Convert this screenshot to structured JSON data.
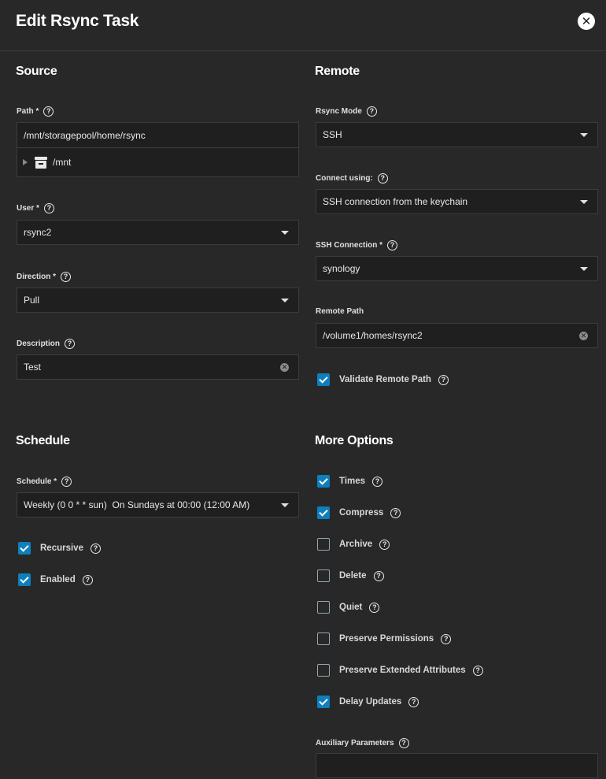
{
  "header": {
    "title": "Edit Rsync Task",
    "close_icon": "close-icon"
  },
  "source": {
    "title": "Source",
    "path_label": "Path *",
    "path_value": "/mnt/storagepool/home/rsync",
    "tree_node": "/mnt",
    "user_label": "User *",
    "user_value": "rsync2",
    "direction_label": "Direction *",
    "direction_value": "Pull",
    "description_label": "Description",
    "description_value": "Test"
  },
  "remote": {
    "title": "Remote",
    "mode_label": "Rsync Mode",
    "mode_value": "SSH",
    "connect_label": "Connect using:",
    "connect_value": "SSH connection from the keychain",
    "ssh_label": "SSH Connection *",
    "ssh_value": "synology",
    "path_label": "Remote Path",
    "path_value": "/volume1/homes/rsync2",
    "validate_label": "Validate Remote Path",
    "validate_checked": true
  },
  "schedule": {
    "title": "Schedule",
    "schedule_label": "Schedule *",
    "schedule_value": "Weekly (0 0 * * sun)  On Sundays at 00:00 (12:00 AM)",
    "recursive_label": "Recursive",
    "recursive_checked": true,
    "enabled_label": "Enabled",
    "enabled_checked": true
  },
  "more": {
    "title": "More Options",
    "options": [
      {
        "label": "Times",
        "checked": true
      },
      {
        "label": "Compress",
        "checked": true
      },
      {
        "label": "Archive",
        "checked": false
      },
      {
        "label": "Delete",
        "checked": false
      },
      {
        "label": "Quiet",
        "checked": false
      },
      {
        "label": "Preserve Permissions",
        "checked": false
      },
      {
        "label": "Preserve Extended Attributes",
        "checked": false
      },
      {
        "label": "Delay Updates",
        "checked": true
      }
    ],
    "aux_label": "Auxiliary Parameters",
    "aux_value": ""
  },
  "help_glyph": "?",
  "colors": {
    "accent": "#0e7fbd",
    "background": "#282828",
    "field": "#1f1f1f"
  }
}
